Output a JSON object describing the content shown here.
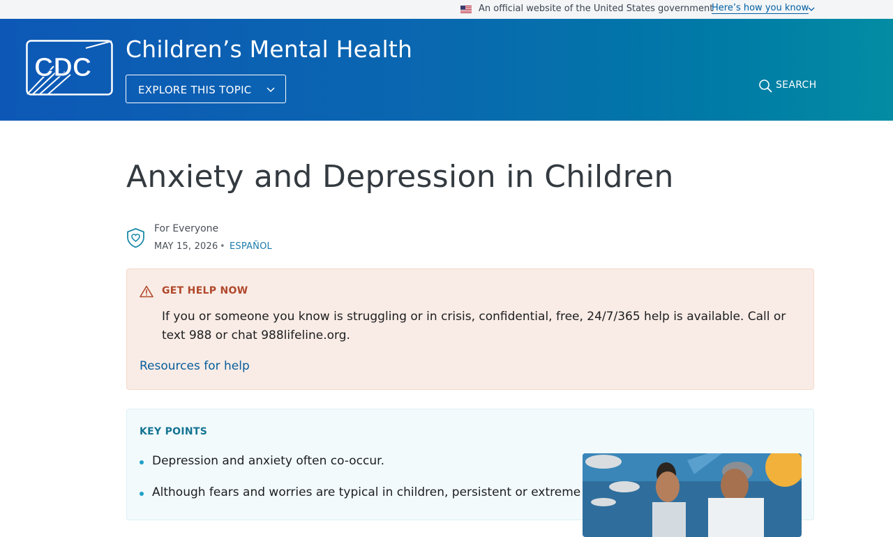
{
  "gov_banner": {
    "text": "An official website of the United States government",
    "link": "Here’s how you know"
  },
  "header": {
    "logo_text": "CDC",
    "site_title": "Children’s Mental Health",
    "explore_label": "EXPLORE THIS TOPIC",
    "search_label": "SEARCH"
  },
  "page": {
    "title": "Anxiety and Depression in Children",
    "audience": "For Everyone",
    "date": "MAY 15, 2026",
    "separator": "•",
    "language_link": "ESPAÑOL"
  },
  "help_box": {
    "heading": "GET HELP NOW",
    "body": "If you or someone you know is struggling or in crisis, confidential, free, 24/7/365 help is available. Call or text 988 or chat 988lifeline.org.",
    "link": "Resources for help"
  },
  "key_points": {
    "heading": "KEY POINTS",
    "items": [
      "Depression and anxiety often co-occur.",
      "Although fears and worries are typical in children, persistent or extreme"
    ]
  },
  "colors": {
    "header_start": "#0d58b6",
    "header_end": "#038ca3",
    "help_accent": "#b0482b",
    "key_accent": "#157493",
    "link": "#065d9c"
  },
  "icons": {
    "flag": "us-flag-icon",
    "chevron": "chevron-down-icon",
    "search": "search-icon",
    "audience": "shield-heart-icon",
    "warning": "warning-triangle-icon"
  }
}
